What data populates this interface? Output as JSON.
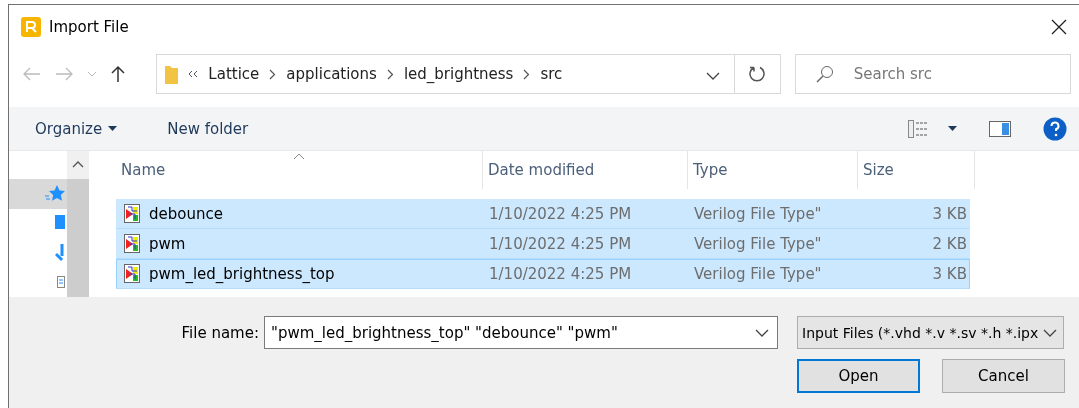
{
  "window": {
    "title": "Import File"
  },
  "address": {
    "crumbs": [
      "Lattice",
      "applications",
      "led_brightness",
      "src"
    ]
  },
  "search": {
    "placeholder": "Search src"
  },
  "toolbar": {
    "organize": "Organize",
    "new_folder": "New folder"
  },
  "columns": [
    {
      "label": "Name",
      "sorted": true
    },
    {
      "label": "Date modified",
      "sorted": false
    },
    {
      "label": "Type",
      "sorted": false
    },
    {
      "label": "Size",
      "sorted": false
    }
  ],
  "rows": [
    {
      "name": "debounce",
      "date": "1/10/2022 4:25 PM",
      "type": "Verilog File Type\"",
      "size": "3 KB",
      "selected": true,
      "focused": false
    },
    {
      "name": "pwm",
      "date": "1/10/2022 4:25 PM",
      "type": "Verilog File Type\"",
      "size": "2 KB",
      "selected": true,
      "focused": false
    },
    {
      "name": "pwm_led_brightness_top",
      "date": "1/10/2022 4:25 PM",
      "type": "Verilog File Type\"",
      "size": "3 KB",
      "selected": true,
      "focused": true
    }
  ],
  "sidebar": {
    "items": [
      {
        "kind": "star",
        "selected": true
      },
      {
        "kind": "desktop",
        "selected": false
      },
      {
        "kind": "download",
        "selected": false
      },
      {
        "kind": "document",
        "selected": false
      }
    ]
  },
  "file_name": {
    "label": "File name:",
    "value": "\"pwm_led_brightness_top\" \"debounce\" \"pwm\""
  },
  "filter": {
    "value": "Input Files (*.vhd *.v *.sv *.h *.ipx"
  },
  "buttons": [
    {
      "label": "Open",
      "default": true
    },
    {
      "label": "Cancel",
      "default": false
    }
  ]
}
